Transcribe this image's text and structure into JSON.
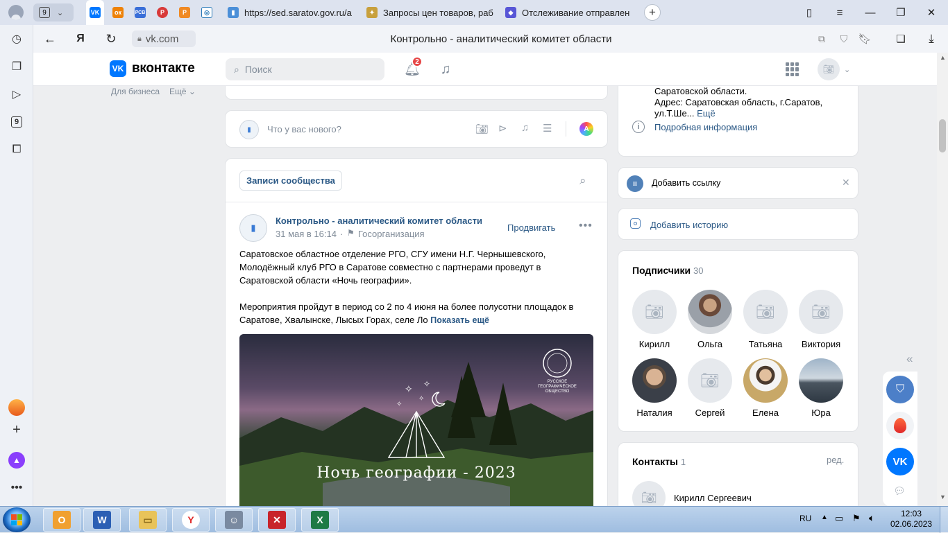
{
  "browser": {
    "tab_count": "9",
    "tabs": [
      {
        "label": "https://sed.saratov.gov.ru/a",
        "icon": "doc-icon"
      },
      {
        "label": "Запросы цен товаров, раб",
        "icon": "coat-of-arms-icon"
      },
      {
        "label": "Отслеживание отправлен",
        "icon": "package-icon"
      }
    ],
    "pinned": [
      {
        "label": "ВК",
        "color": "#0077ff"
      },
      {
        "label": "ОК",
        "color": "#ee8208"
      },
      {
        "label": "РСВ",
        "color": "#3a6fd8"
      },
      {
        "label": "Р",
        "color": "#d83a3a"
      },
      {
        "label": "Р",
        "color": "#f08a24"
      },
      {
        "label": "◎",
        "color": "#2a7ab8"
      }
    ],
    "url_domain": "vk.com",
    "page_title": "Контрольно - аналитический комитет области",
    "sidebar_badge": "9",
    "tab_new": "+"
  },
  "vk": {
    "logo_text": "вконтакте",
    "search_placeholder": "Поиск",
    "notif_count": "2",
    "left_links": [
      "Для бизнеса",
      "Ещё"
    ],
    "composer_placeholder": "Что у вас нового?",
    "tab_label": "Записи сообщества",
    "post": {
      "author": "Контрольно - аналитический комитет области",
      "date": "31 мая в 16:14",
      "category": "Госорганизация",
      "promote": "Продвигать",
      "text1": "Саратовское областное отделение РГО, СГУ имени Н.Г. Чернышевского, Молодёжный клуб РГО в Саратове совместно с партнерами проведут в Саратовской области «Ночь географии».",
      "text2": "Мероприятия пройдут в период со 2 по 4 июня на более полусотни площадок в Саратове, Хвалынске, Лысых Горах, селе Ло",
      "show_more": "Показать ещё",
      "image_title": "Ночь географии - 2023",
      "image_org": "РУССКОЕ ГЕОГРАФИЧЕСКОЕ ОБЩЕСТВО"
    },
    "info": {
      "line1": "Саратовской области.",
      "line2": "Адрес: Саратовская область, г.Саратов,",
      "line3": "ул.Т.Ше...",
      "more": "Ещё",
      "details": "Подробная информация"
    },
    "add_link": "Добавить ссылку",
    "add_story": "Добавить историю",
    "subscribers": {
      "title": "Подписчики",
      "count": "30",
      "people": [
        {
          "name": "Кирилл",
          "photo": "camera-placeholder"
        },
        {
          "name": "Ольга",
          "photo": "photo"
        },
        {
          "name": "Татьяна",
          "photo": "camera-placeholder"
        },
        {
          "name": "Виктория",
          "photo": "camera-placeholder"
        },
        {
          "name": "Наталия",
          "photo": "photo"
        },
        {
          "name": "Сергей",
          "photo": "camera-placeholder"
        },
        {
          "name": "Елена",
          "photo": "photo"
        },
        {
          "name": "Юра",
          "photo": "photo"
        }
      ]
    },
    "contacts": {
      "title": "Контакты",
      "count": "1",
      "edit": "ред.",
      "first": "Кирилл Сергеевич"
    }
  },
  "taskbar": {
    "lang": "RU",
    "time": "12:03",
    "date": "02.06.2023",
    "apps": [
      "outlook",
      "word",
      "explorer",
      "yandex-browser",
      "app",
      "adobe",
      "excel"
    ]
  },
  "colors": {
    "vk_blue": "#0077ff",
    "link": "#2a5885",
    "badge_red": "#e64646"
  }
}
